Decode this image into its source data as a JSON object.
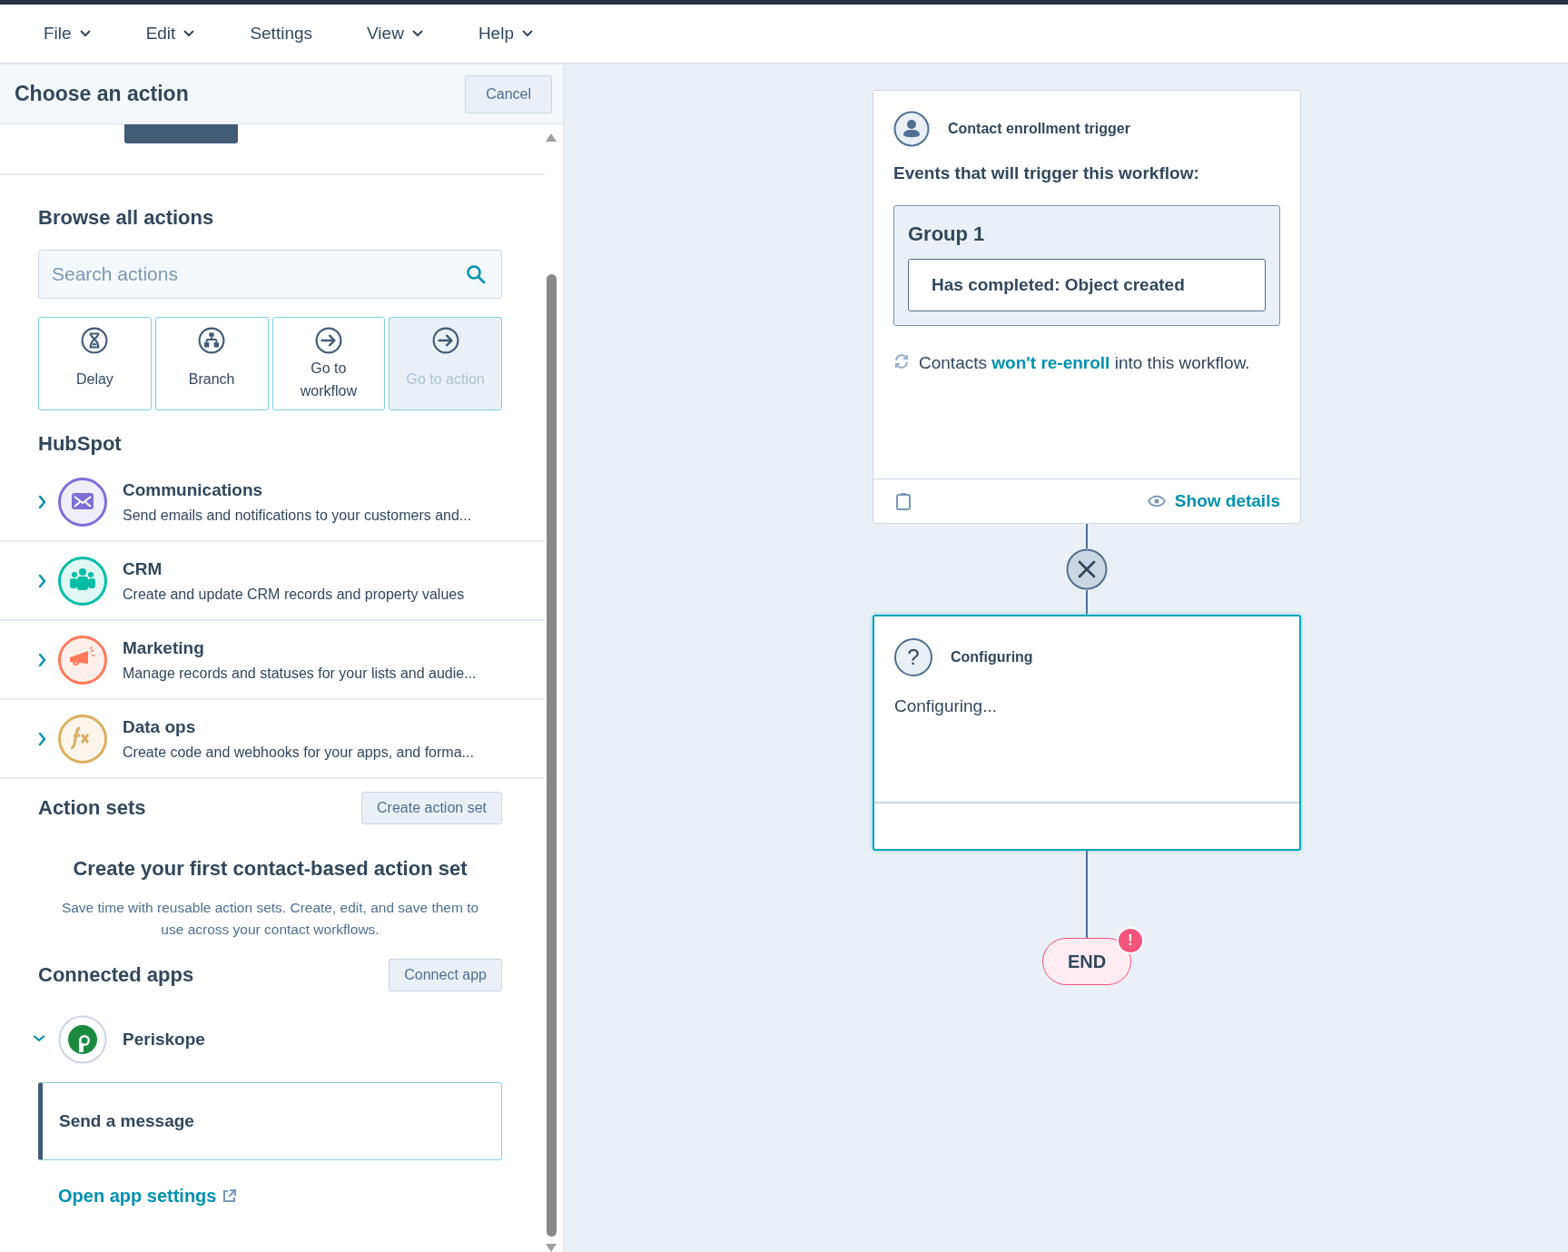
{
  "menu": [
    {
      "label": "File",
      "dropdown": true
    },
    {
      "label": "Edit",
      "dropdown": true
    },
    {
      "label": "Settings",
      "dropdown": false
    },
    {
      "label": "View",
      "dropdown": true
    },
    {
      "label": "Help",
      "dropdown": true
    }
  ],
  "panel": {
    "title": "Choose an action",
    "cancel": "Cancel",
    "browse": {
      "title": "Browse all actions",
      "search": {
        "placeholder": "Search actions"
      },
      "tiles": [
        {
          "kind": "delay",
          "label": "Delay",
          "disabled": false
        },
        {
          "kind": "branch",
          "label": "Branch",
          "disabled": false
        },
        {
          "kind": "goto",
          "label": "Go to workflow",
          "disabled": false
        },
        {
          "kind": "goto",
          "label": "Go to action",
          "disabled": true
        }
      ]
    },
    "hubspot": {
      "title": "HubSpot",
      "categories": [
        {
          "kind": "mail",
          "title": "Communications",
          "description": "Send emails and notifications to your customers and...",
          "color": "#7c6fd6",
          "expanded": false
        },
        {
          "kind": "people",
          "title": "CRM",
          "description": "Create and update CRM records and property values",
          "color": "#00bda5",
          "expanded": false
        },
        {
          "kind": "megaphone",
          "title": "Marketing",
          "description": "Manage records and statuses for your lists and audie...",
          "color": "#ff7a59",
          "expanded": false
        },
        {
          "kind": "formula",
          "title": "Data ops",
          "description": "Create code and webhooks for your apps, and forma...",
          "color": "#dbae60",
          "expanded": false
        }
      ]
    },
    "action_sets": {
      "title": "Action sets",
      "button": "Create action set",
      "empty_title": "Create your first contact-based action set",
      "empty_text": "Save time with reusable action sets. Create, edit, and save them to use across your contact workflows."
    },
    "connected_apps": {
      "title": "Connected apps",
      "button": "Connect app",
      "apps": [
        {
          "name": "Periskope",
          "expanded": true,
          "actions": [
            "Send a message"
          ],
          "settings_link": "Open app settings"
        }
      ]
    }
  },
  "canvas": {
    "trigger": {
      "title": "Contact enrollment trigger",
      "subtitle": "Events that will trigger this workflow:",
      "group": "Group 1",
      "filters": [
        "Has completed: Object created"
      ],
      "reenroll": "Contacts **won't re-enroll** into this workflow.",
      "details_link": "Show details"
    },
    "action": {
      "icon": "?",
      "title": "Configuring",
      "body": "Configuring...",
      "selected": true
    },
    "end": {
      "label": "END",
      "alert": "!"
    }
  }
}
